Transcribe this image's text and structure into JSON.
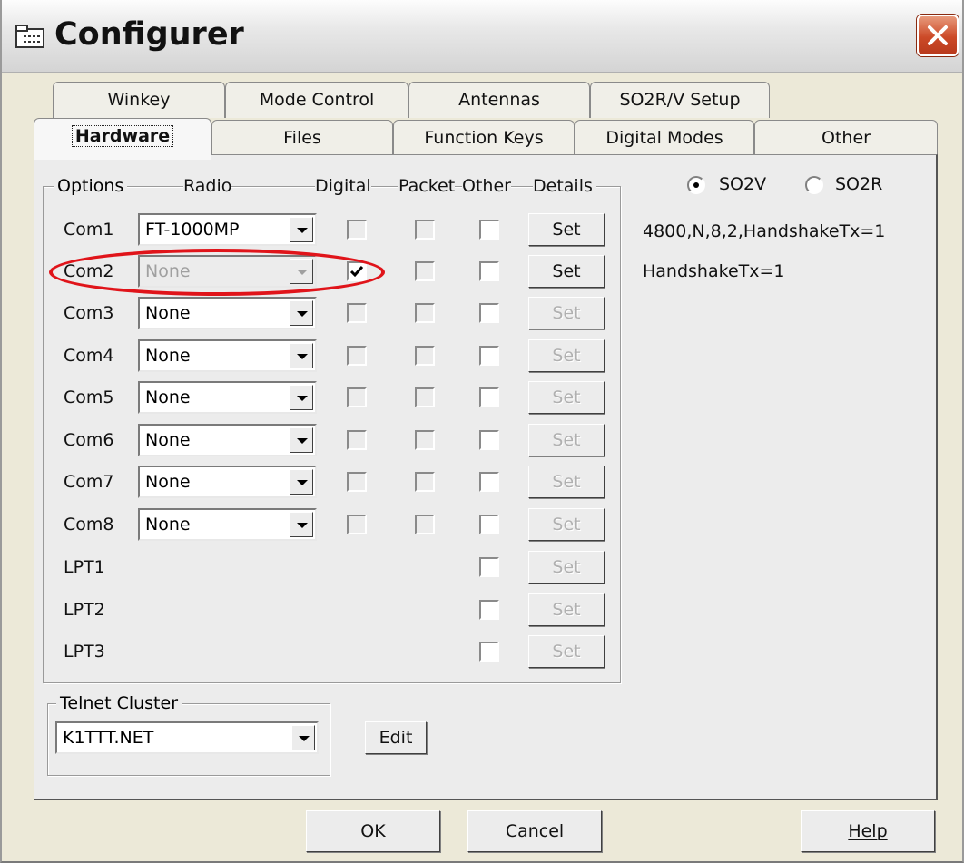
{
  "window": {
    "title": "Configurer"
  },
  "tabs_back": [
    "Winkey",
    "Mode Control",
    "Antennas",
    "SO2R/V Setup"
  ],
  "tabs_front": [
    "Hardware",
    "Files",
    "Function Keys",
    "Digital Modes",
    "Other"
  ],
  "active_tab": "Hardware",
  "options_group": {
    "legend": "Options",
    "headers": {
      "radio": "Radio",
      "digital": "Digital",
      "packet": "Packet",
      "other": "Other",
      "details": "Details"
    },
    "ports": [
      {
        "name": "Com1",
        "radio": "FT-1000MP",
        "radio_enabled": true,
        "digital": false,
        "packet": false,
        "other": false,
        "set_label": "Set",
        "set_enabled": true
      },
      {
        "name": "Com2",
        "radio": "None",
        "radio_enabled": false,
        "digital": true,
        "packet": false,
        "other": false,
        "set_label": "Set",
        "set_enabled": true
      },
      {
        "name": "Com3",
        "radio": "None",
        "radio_enabled": true,
        "digital": false,
        "packet": false,
        "other": false,
        "set_label": "Set",
        "set_enabled": false
      },
      {
        "name": "Com4",
        "radio": "None",
        "radio_enabled": true,
        "digital": false,
        "packet": false,
        "other": false,
        "set_label": "Set",
        "set_enabled": false
      },
      {
        "name": "Com5",
        "radio": "None",
        "radio_enabled": true,
        "digital": false,
        "packet": false,
        "other": false,
        "set_label": "Set",
        "set_enabled": false
      },
      {
        "name": "Com6",
        "radio": "None",
        "radio_enabled": true,
        "digital": false,
        "packet": false,
        "other": false,
        "set_label": "Set",
        "set_enabled": false
      },
      {
        "name": "Com7",
        "radio": "None",
        "radio_enabled": true,
        "digital": false,
        "packet": false,
        "other": false,
        "set_label": "Set",
        "set_enabled": false
      },
      {
        "name": "Com8",
        "radio": "None",
        "radio_enabled": true,
        "digital": false,
        "packet": false,
        "other": false,
        "set_label": "Set",
        "set_enabled": false
      }
    ],
    "lpt_ports": [
      {
        "name": "LPT1",
        "other": false,
        "set_label": "Set"
      },
      {
        "name": "LPT2",
        "other": false,
        "set_label": "Set"
      },
      {
        "name": "LPT3",
        "other": false,
        "set_label": "Set"
      }
    ]
  },
  "so2": {
    "so2v_label": "SO2V",
    "so2r_label": "SO2R",
    "selected": "SO2V"
  },
  "details_info": [
    "4800,N,8,2,HandshakeTx=1",
    "HandshakeTx=1"
  ],
  "telnet": {
    "legend": "Telnet Cluster",
    "value": "K1TTT.NET",
    "edit_label": "Edit"
  },
  "footer": {
    "ok_label": "OK",
    "cancel_label": "Cancel",
    "help_label": "Help"
  },
  "annotation": {
    "color": "#e0141a"
  }
}
